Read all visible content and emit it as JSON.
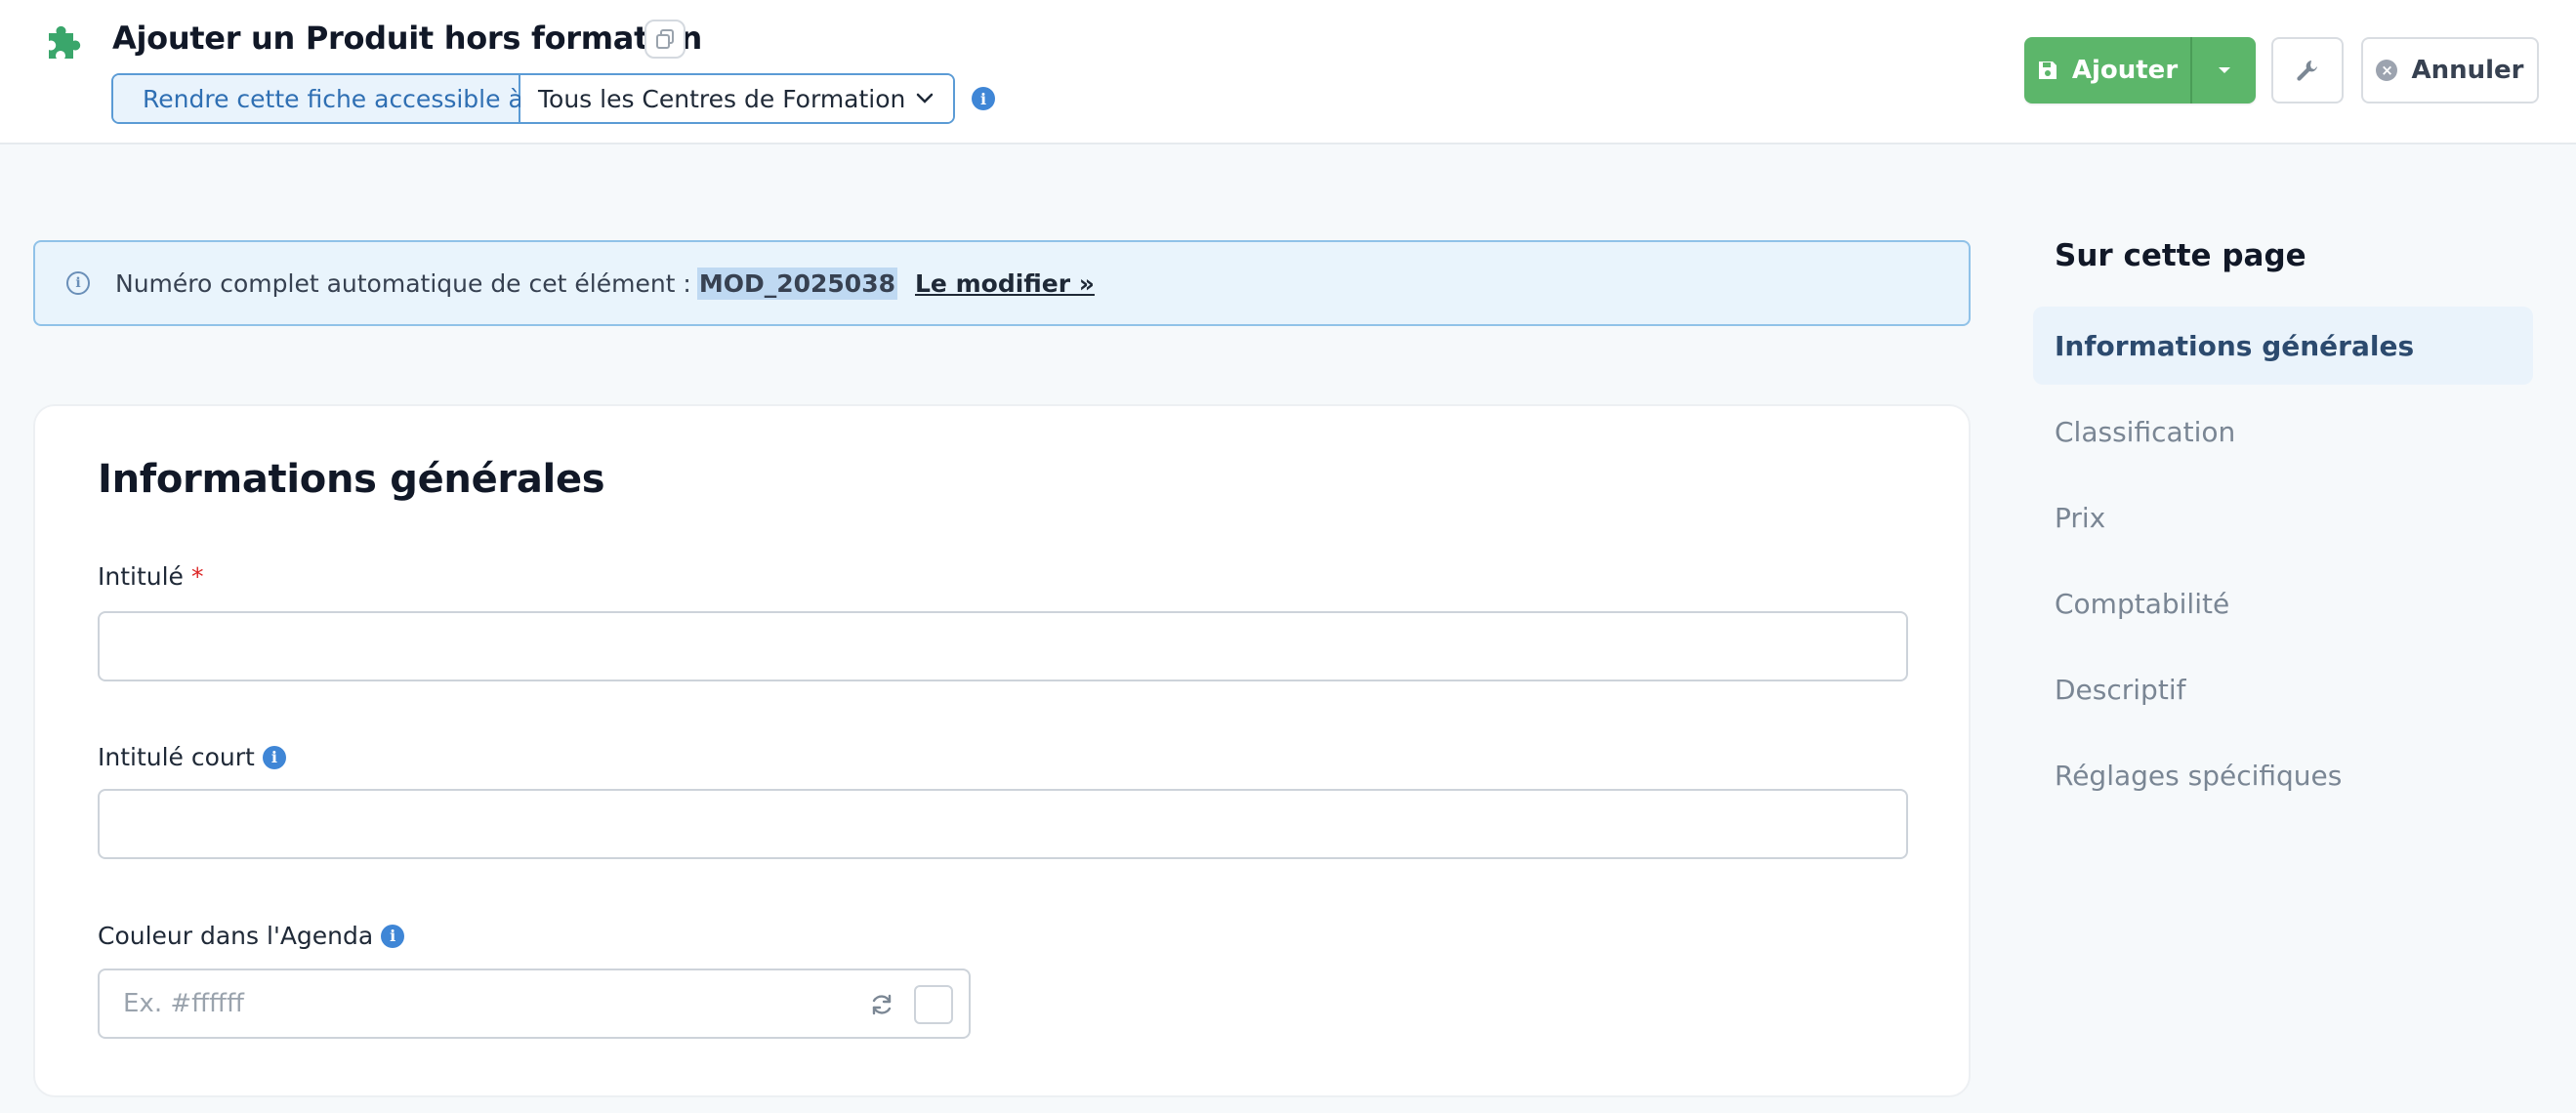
{
  "header": {
    "title": "Ajouter un Produit hors formation",
    "access_label": "Rendre cette fiche accessible à",
    "access_value": "Tous les Centres de Formation",
    "add_label": "Ajouter",
    "cancel_label": "Annuler"
  },
  "banner": {
    "text": "Numéro complet automatique de cet élément :",
    "code": "MOD_2025038",
    "link": "Le modifier »"
  },
  "section": {
    "title": "Informations générales",
    "fields": {
      "intitule": {
        "label": "Intitulé",
        "required_mark": "*",
        "value": ""
      },
      "intitule_court": {
        "label": "Intitulé court",
        "value": ""
      },
      "couleur": {
        "label": "Couleur dans l'Agenda",
        "placeholder": "Ex. #ffffff"
      }
    }
  },
  "toc": {
    "title": "Sur cette page",
    "items": [
      {
        "label": "Informations générales",
        "active": true
      },
      {
        "label": "Classification"
      },
      {
        "label": "Prix"
      },
      {
        "label": "Comptabilité"
      },
      {
        "label": "Descriptif"
      },
      {
        "label": "Réglages spécifiques"
      }
    ]
  },
  "colors": {
    "accent_green": "#5cb66a",
    "info_blue": "#3f86d6",
    "banner_bg": "#e9f4fc",
    "puzzle_green": "#3aa66b"
  },
  "icons": {
    "app": "puzzle-icon",
    "copy": "copy-icon",
    "eye": "eye-icon",
    "chevron": "chevron-down-icon",
    "info": "info-icon",
    "save": "floppy-disk-icon",
    "caret": "caret-down-icon",
    "wrench": "wrench-icon",
    "cancel": "x-circle-icon",
    "refresh": "refresh-icon"
  }
}
